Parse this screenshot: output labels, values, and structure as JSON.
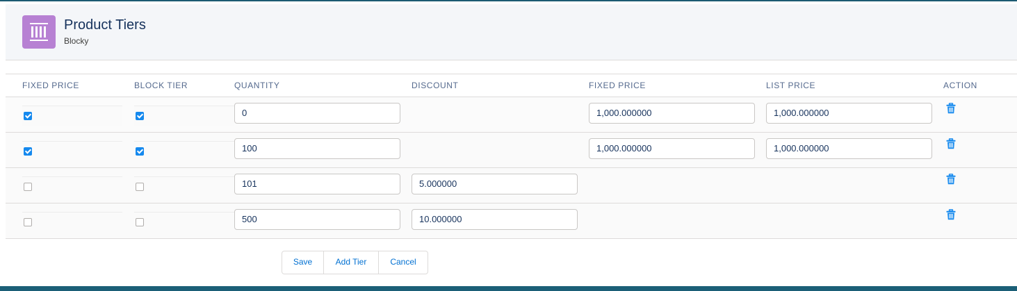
{
  "header": {
    "title": "Product Tiers",
    "subtitle": "Blocky",
    "icon": "product-tiers-icon",
    "icon_color": "#b781d3"
  },
  "table": {
    "columns": [
      "FIXED PRICE",
      "BLOCK TIER",
      "QUANTITY",
      "DISCOUNT",
      "FIXED PRICE",
      "LIST PRICE",
      "ACTION"
    ],
    "rows": [
      {
        "fixed_price_checked": true,
        "block_tier_checked": true,
        "quantity": "0",
        "discount": "",
        "fixed_price": "1,000.000000",
        "list_price": "1,000.000000"
      },
      {
        "fixed_price_checked": true,
        "block_tier_checked": true,
        "quantity": "100",
        "discount": "",
        "fixed_price": "1,000.000000",
        "list_price": "1,000.000000"
      },
      {
        "fixed_price_checked": false,
        "block_tier_checked": false,
        "quantity": "101",
        "discount": "5.000000",
        "fixed_price": "",
        "list_price": ""
      },
      {
        "fixed_price_checked": false,
        "block_tier_checked": false,
        "quantity": "500",
        "discount": "10.000000",
        "fixed_price": "",
        "list_price": ""
      }
    ],
    "action_icon": "trash-icon"
  },
  "buttons": {
    "save": "Save",
    "add_tier": "Add Tier",
    "cancel": "Cancel"
  },
  "colors": {
    "accent": "#0070d2",
    "checkbox_checked": "#1589ee",
    "footer_bar": "#1b5f77"
  }
}
